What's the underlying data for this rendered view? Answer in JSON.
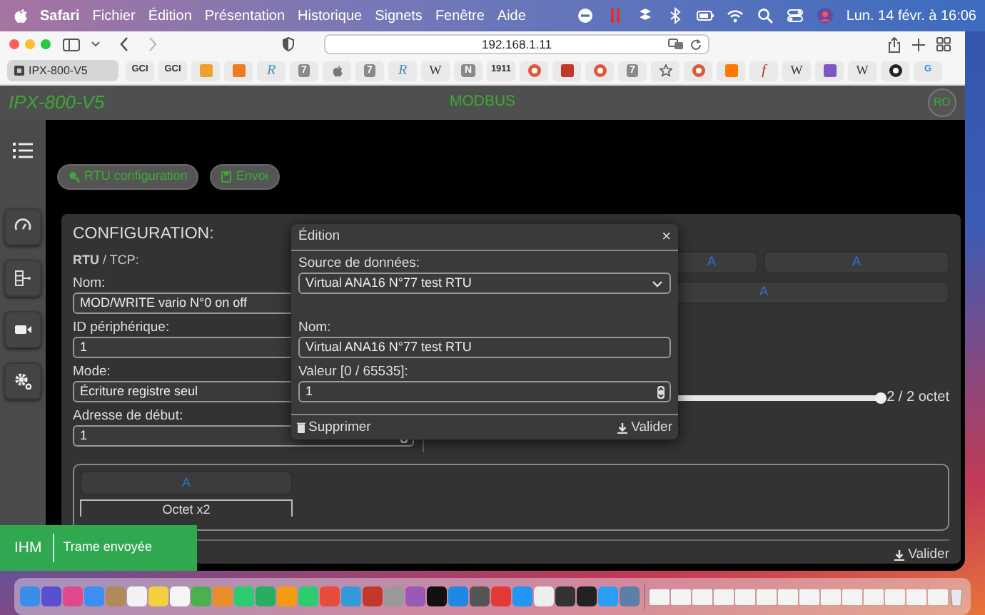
{
  "menubar": {
    "app": "Safari",
    "menus": [
      "Fichier",
      "Édition",
      "Présentation",
      "Historique",
      "Signets",
      "Fenêtre",
      "Aide"
    ],
    "clock": "Lun. 14 févr. à 16:06"
  },
  "browser": {
    "address": "192.168.1.11",
    "back_disabled": false,
    "forward_disabled": true,
    "tab": "IPX-800-V5",
    "bookmarks": [
      {
        "kind": "text",
        "text": "GCI"
      },
      {
        "kind": "text",
        "text": "GCI"
      },
      {
        "kind": "tile",
        "color": "#f0a030"
      },
      {
        "kind": "tile",
        "color": "#f07a20"
      },
      {
        "kind": "italic",
        "text": "R",
        "color": "#4a90b8"
      },
      {
        "kind": "badge",
        "text": "7"
      },
      {
        "kind": "apple"
      },
      {
        "kind": "badge",
        "text": "7"
      },
      {
        "kind": "italic",
        "text": "R",
        "color": "#4a90b8"
      },
      {
        "kind": "serif",
        "text": "W"
      },
      {
        "kind": "badge",
        "text": "N"
      },
      {
        "kind": "text",
        "text": "1911"
      },
      {
        "kind": "circle",
        "color": "#de5833"
      },
      {
        "kind": "tile",
        "color": "#c0392b"
      },
      {
        "kind": "circle",
        "color": "#de5833"
      },
      {
        "kind": "badge",
        "text": "7"
      },
      {
        "kind": "star"
      },
      {
        "kind": "circle",
        "color": "#de5833"
      },
      {
        "kind": "tile",
        "color": "#ff7900"
      },
      {
        "kind": "italic",
        "text": "f",
        "color": "#c0282d"
      },
      {
        "kind": "serif",
        "text": "W"
      },
      {
        "kind": "tile",
        "color": "#7e57c2"
      },
      {
        "kind": "serif",
        "text": "W"
      },
      {
        "kind": "circle",
        "color": "#222222"
      },
      {
        "kind": "text",
        "text": "G",
        "color": "#4285f4"
      }
    ]
  },
  "app": {
    "brand": "IPX-800-V5",
    "title": "MODBUS",
    "user": "RO",
    "actions": [
      "RTU configuration",
      "Envoi"
    ],
    "config": {
      "heading": "CONFIGURATION:",
      "protocol": "**RTU** / TCP:",
      "fields": [
        {
          "label": "Nom:",
          "kind": "text",
          "value": "MOD/WRITE vario N°0 on off"
        },
        {
          "label": "ID périphérique:",
          "kind": "text",
          "value": "1"
        },
        {
          "label": "Mode:",
          "kind": "select",
          "value": "Écriture registre seul"
        },
        {
          "label": "Adresse de début:",
          "kind": "number",
          "value": "1"
        }
      ],
      "register_rows": [
        [
          "A",
          "A"
        ],
        [
          "A"
        ]
      ],
      "slider": {
        "level": 1,
        "reading": "2 / 2 octet"
      },
      "bytes": [
        {
          "button": "A",
          "label": "Octet x2"
        }
      ],
      "submit": "Valider"
    }
  },
  "modal": {
    "title": "Édition",
    "close": "×",
    "fields": [
      {
        "label": "Source de données:",
        "kind": "select",
        "value": "Virtual ANA16 N°77 test RTU"
      },
      {
        "label": "Nom:",
        "kind": "text",
        "value": "Virtual ANA16 N°77 test RTU"
      },
      {
        "label": "Valeur [0 / 65535]:",
        "kind": "number",
        "value": "1"
      }
    ],
    "delete": "Supprimer",
    "submit": "Valider"
  },
  "toast": {
    "source": "IHM",
    "message": "Trame envoyée"
  }
}
